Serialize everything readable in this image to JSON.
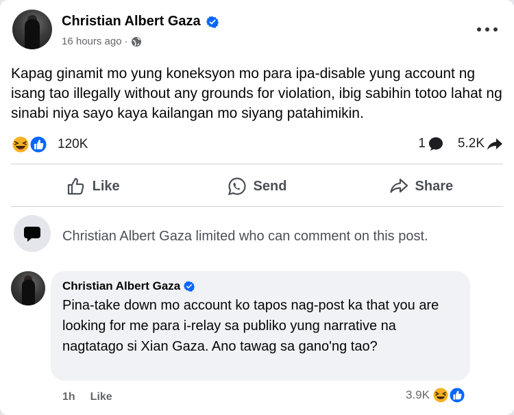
{
  "post": {
    "author": "Christian Albert Gaza",
    "time": "16 hours ago",
    "separator": "·",
    "text": "Kapag ginamit mo yung koneksyon mo para ipa-disable yung account ng isang tao illegally without any grounds for violation, ibig sabihin totoo lahat ng sinabi niya sayo kaya kailangan mo siyang patahimikin.",
    "reaction_count": "120K",
    "comment_count": "1",
    "share_count": "5.2K"
  },
  "actions": {
    "like": "Like",
    "send": "Send",
    "share": "Share"
  },
  "notice": {
    "text": "Christian Albert Gaza limited who can comment on this post."
  },
  "comment": {
    "author": "Christian Albert Gaza",
    "text": "Pina-take down mo account ko tapos nag-post ka that you are looking for me para i-relay sa publiko yung narrative na nagtatago si Xian Gaza. Ano tawag sa gano'ng tao?",
    "time": "1h",
    "like": "Like",
    "reaction_count": "3.9K"
  },
  "icons": {
    "verified": "verified-badge-icon",
    "globe": "globe-icon",
    "more": "more-options-icon",
    "haha": "haha-reaction-icon",
    "like_reaction": "like-reaction-icon",
    "comment": "comment-bubble-icon",
    "share": "share-arrow-icon",
    "thumb": "thumbs-up-icon",
    "messenger": "whatsapp-send-icon",
    "share_outline": "share-outline-icon",
    "limited": "chat-bubble-icon"
  },
  "colors": {
    "accent": "#0866ff",
    "muted": "#65676b",
    "bubble": "#f0f2f5"
  }
}
